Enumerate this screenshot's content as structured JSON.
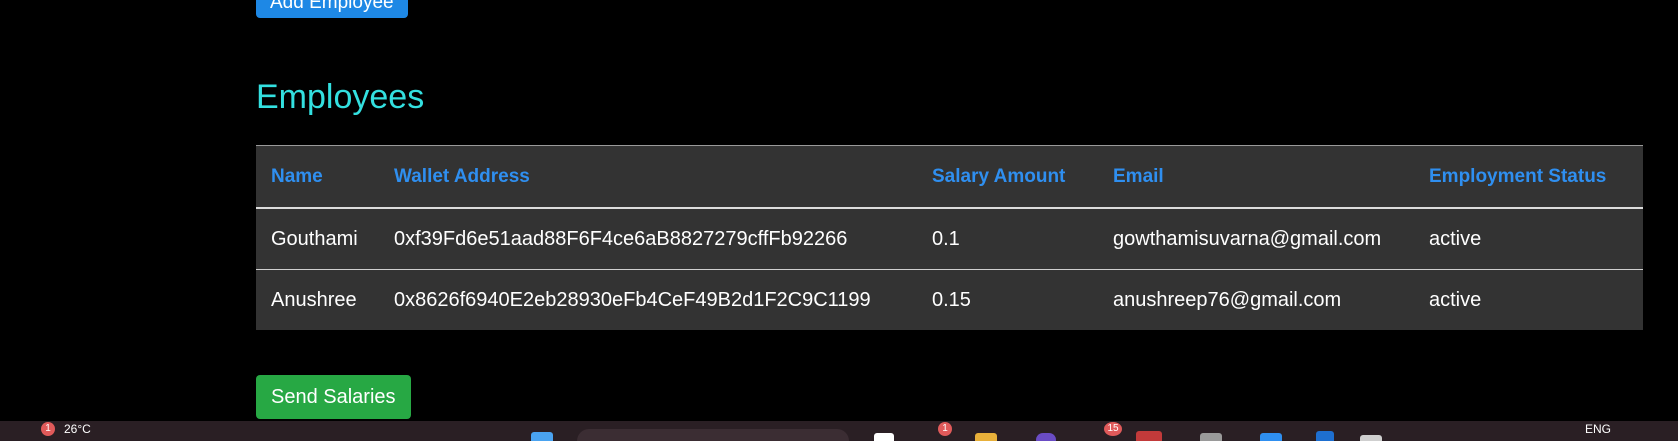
{
  "add_employee_label": "Add Employee",
  "section_title": "Employees",
  "table": {
    "headers": [
      "Name",
      "Wallet Address",
      "Salary Amount",
      "Email",
      "Employment Status"
    ],
    "rows": [
      [
        "Gouthami",
        "0xf39Fd6e51aad88F6F4ce6aB8827279cffFb92266",
        "0.1",
        "gowthamisuvarna@gmail.com",
        "active"
      ],
      [
        "Anushree",
        "0x8626f6940E2eb28930eFb4CeF49B2d1F2C9C1199",
        "0.15",
        "anushreep76@gmail.com",
        "active"
      ]
    ]
  },
  "send_salaries_label": "Send Salaries",
  "taskbar": {
    "weather_badge": "1",
    "weather_temp": "26°C",
    "app_badge_1": "1",
    "app_badge_2": "15",
    "language": "ENG"
  }
}
